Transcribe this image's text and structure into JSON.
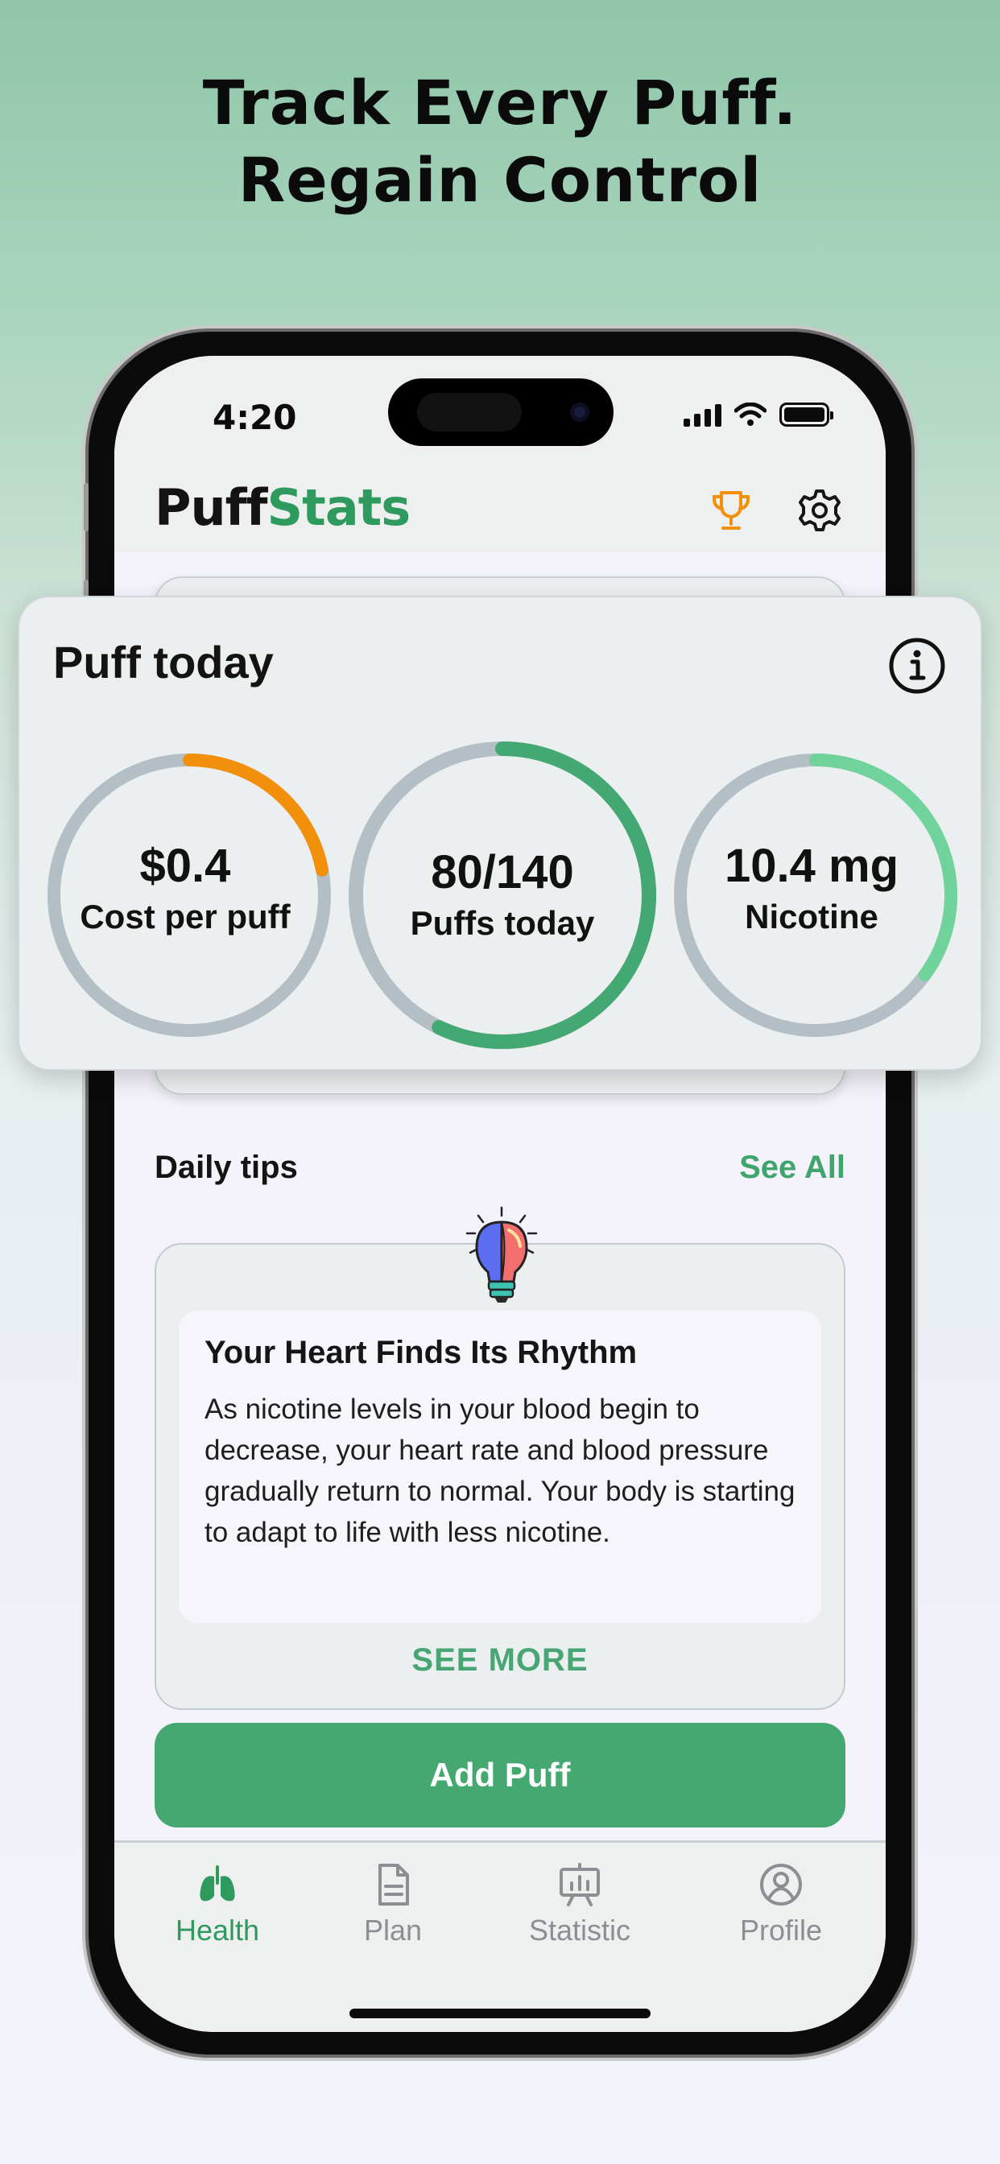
{
  "headline": {
    "line1": "Track Every Puff.",
    "line2": "Regain Control"
  },
  "status_bar": {
    "time": "4:20"
  },
  "header": {
    "logo_part1": "Puff",
    "logo_part2": "Stats",
    "trophy_icon": "trophy-icon",
    "settings_icon": "gear-icon"
  },
  "puff_card": {
    "title": "Puff today",
    "info_icon": "info-icon",
    "gauges": [
      {
        "value": "$0.4",
        "label": "Cost per puff",
        "progress": 0.22,
        "color": "#f2900c"
      },
      {
        "value": "80/140",
        "label": "Puffs today",
        "progress": 0.571,
        "color": "#43a871"
      },
      {
        "value": "10.4 mg",
        "label": "Nicotine",
        "progress": 0.35,
        "color": "#6fd39b"
      }
    ]
  },
  "tips": {
    "section_title": "Daily tips",
    "see_all": "See All",
    "card_title": "Your Heart Finds Its Rhythm",
    "card_body": "As nicotine levels in your blood begin to decrease, your heart rate and blood pressure gradually return to normal. Your body is starting to adapt to life with less nicotine.",
    "see_more": "SEE MORE",
    "icon": "lightbulb-icon"
  },
  "actions": {
    "add_puff": "Add Puff"
  },
  "tabbar": {
    "items": [
      {
        "label": "Health",
        "icon": "lungs-icon",
        "active": true
      },
      {
        "label": "Plan",
        "icon": "document-icon",
        "active": false
      },
      {
        "label": "Statistic",
        "icon": "presentation-chart-icon",
        "active": false
      },
      {
        "label": "Profile",
        "icon": "user-circle-icon",
        "active": false
      }
    ]
  },
  "colors": {
    "brand_green": "#2f9a5e",
    "button_green": "#44a870",
    "accent_orange": "#f2900c"
  }
}
